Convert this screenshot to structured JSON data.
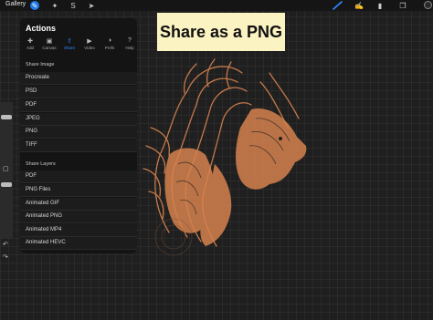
{
  "topbar": {
    "gallery_label": "Gallery",
    "icons": [
      "wrench-icon",
      "wand-icon",
      "selection-icon",
      "transform-icon",
      "brush-icon",
      "smudge-icon",
      "eraser-icon",
      "layers-icon",
      "color-icon"
    ]
  },
  "banner": {
    "text": "Share as a PNG"
  },
  "actions_panel": {
    "title": "Actions",
    "tabs": [
      {
        "label": "Add",
        "icon": "add-icon"
      },
      {
        "label": "Canvas",
        "icon": "canvas-icon"
      },
      {
        "label": "Share",
        "icon": "share-icon",
        "active": true
      },
      {
        "label": "Video",
        "icon": "video-icon"
      },
      {
        "label": "Prefs",
        "icon": "prefs-icon"
      },
      {
        "label": "Help",
        "icon": "help-icon"
      }
    ],
    "share_image": {
      "label": "Share Image",
      "items": [
        "Procreate",
        "PSD",
        "PDF",
        "JPEG",
        "PNG",
        "TIFF"
      ]
    },
    "share_layers": {
      "label": "Share Layers",
      "items": [
        "PDF",
        "PNG Files",
        "Animated GIF",
        "Animated PNG",
        "Animated MP4",
        "Animated HEVC"
      ]
    }
  },
  "colors": {
    "accent": "#1f7ae8",
    "banner": "#fbf3c2",
    "artwork": "#d6824e"
  }
}
